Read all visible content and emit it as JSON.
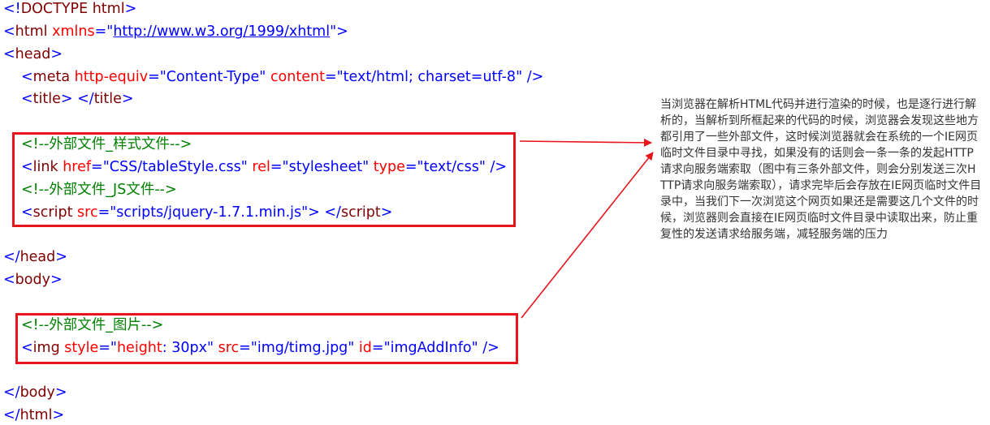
{
  "code": {
    "doctype": {
      "open": "<!",
      "keyword": "DOCTYPE html",
      "close": ">"
    },
    "html_open": {
      "lt": "<",
      "tag": "html",
      "attr": "xmlns",
      "eq": "=\"",
      "url": "http://www.w3.org/1999/xhtml",
      "end": "\">"
    },
    "head_open": {
      "lt": "<",
      "tag": "head",
      "gt": ">"
    },
    "meta": {
      "lt": "<",
      "tag": "meta",
      "attr1": "http-equiv",
      "val1": "=\"Content-Type\"",
      "attr2": "content",
      "val2": "=\"text/html; charset=utf-8\"",
      "end": " />"
    },
    "title": {
      "lt": "<",
      "tag": "title",
      "mid": "> </",
      "tag2": "title",
      "gt": ">"
    },
    "comment_css": "<!--外部文件_样式文件-->",
    "link": {
      "lt": "<",
      "tag": "link",
      "attr1": "href",
      "val1": "=\"CSS/tableStyle.css\"",
      "attr2": "rel",
      "val2": "=\"stylesheet\"",
      "attr3": "type",
      "val3": "=\"text/css\"",
      "end": " />"
    },
    "comment_js": "<!--外部文件_JS文件-->",
    "script": {
      "lt": "<",
      "tag": "script",
      "attr1": "src",
      "val1": "=\"scripts/jquery-1.7.1.min.js\"",
      "mid": "> </",
      "tag2": "script",
      "gt": ">"
    },
    "head_close": {
      "lt": "</",
      "tag": "head",
      "gt": ">"
    },
    "body_open": {
      "lt": "<",
      "tag": "body",
      "gt": ">"
    },
    "comment_img": "<!--外部文件_图片-->",
    "img": {
      "lt": "<",
      "tag": "img",
      "attr1": "style",
      "eq1": "=\"",
      "attr1b": "height",
      "val1": ": 30px\"",
      "attr2": "src",
      "val2": "=\"img/timg.jpg\"",
      "attr3": "id",
      "val3": "=\"imgAddInfo\"",
      "end": " />"
    },
    "body_close": {
      "lt": "</",
      "tag": "body",
      "gt": ">"
    },
    "html_close": {
      "lt": "</",
      "tag": "html",
      "gt": ">"
    }
  },
  "annotation": {
    "text": "当浏览器在解析HTML代码并进行渲染的时候，也是逐行进行解析的，当解析到所框起来的代码的时候，浏览器会发现这些地方都引用了一些外部文件，这时候浏览器就会在系统的一个IE网页临时文件目录中寻找，如果没有的话则会一条一条的发起HTTP请求向服务端索取（图中有三条外部文件，则会分别发送三次HTTP请求向服务端索取），请求完毕后会存放在IE网页临时文件目录中，当我们下一次浏览这个网页如果还是需要这几个文件的时候，浏览器则会直接在IE网页临时文件目录中读取出来，防止重复性的发送请求给服务端，减轻服务端的压力"
  },
  "colors": {
    "tag": "#800000",
    "attribute": "#ff0000",
    "value": "#0000ff",
    "comment": "#008000",
    "highlight": "#e8131b"
  }
}
